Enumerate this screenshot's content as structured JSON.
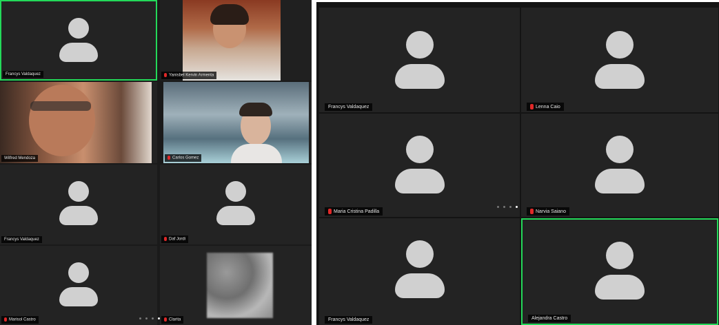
{
  "left_window": {
    "participants": [
      {
        "name": "Francys Valdaquez",
        "muted": false
      },
      {
        "name": "Yanisbel Kervin Armenta",
        "muted": true
      },
      {
        "name": "Wilfred Mendoza",
        "muted": false
      },
      {
        "name": "Carlos Gomez",
        "muted": true
      },
      {
        "name": "Francys Valdaquez",
        "muted": false
      },
      {
        "name": "Daf Jordi",
        "muted": true
      },
      {
        "name": "Marisol Castro",
        "muted": true
      },
      {
        "name": "Clarita",
        "muted": true
      }
    ]
  },
  "right_window": {
    "participants": [
      {
        "name": "Francys Valdaquez",
        "muted": false
      },
      {
        "name": "Lenna Caio",
        "muted": true
      },
      {
        "name": "Maria Cristina Padilla",
        "muted": true
      },
      {
        "name": "Narvia Saiano",
        "muted": true
      },
      {
        "name": "Francys Valdaquez",
        "muted": false
      },
      {
        "name": "Alejandra Castro",
        "muted": false
      }
    ]
  },
  "colors": {
    "active_speaker": "#23d959",
    "muted_icon": "#e02828",
    "tile_background": "#232323"
  },
  "icons": [
    "avatar-icon",
    "microphone-muted-icon",
    "page-dots-icon"
  ]
}
